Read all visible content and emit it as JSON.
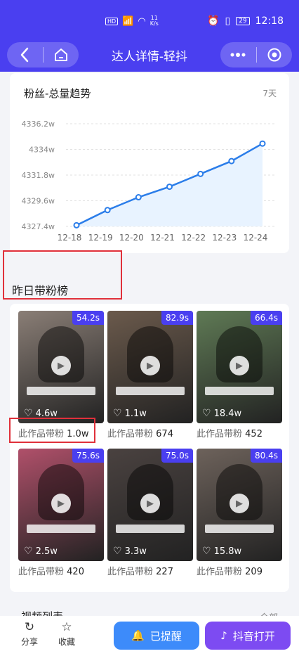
{
  "status_bar": {
    "hd": "HD",
    "net_speed_top": "11",
    "net_speed_bottom": "K/s",
    "battery": "29",
    "time": "12:18"
  },
  "nav": {
    "title": "达人详情-轻抖"
  },
  "fans_trend": {
    "title": "粉丝-总量趋势",
    "period": "7天"
  },
  "chart_data": {
    "type": "area",
    "title": "粉丝-总量趋势",
    "categories": [
      "12-18",
      "12-19",
      "12-20",
      "12-21",
      "12-22",
      "12-23",
      "12-24"
    ],
    "values": [
      4327.5,
      4328.8,
      4329.9,
      4330.8,
      4331.9,
      4333.0,
      4334.5
    ],
    "y_ticks": [
      "4336.2w",
      "4334w",
      "4331.8w",
      "4329.6w",
      "4327.4w"
    ],
    "ylim": [
      4327.4,
      4336.2
    ],
    "unit": "w",
    "grid": true,
    "line_color": "#2b7de9",
    "fill_color": "#e8f3ff"
  },
  "ranking": {
    "title": "昨日带粉榜",
    "caption_prefix": "此作品带粉",
    "videos": [
      {
        "duration": "54.2s",
        "likes": "4.6w",
        "fans": "1.0w",
        "color": "#8a7e76"
      },
      {
        "duration": "82.9s",
        "likes": "1.1w",
        "fans": "674",
        "color": "#6b5a4c"
      },
      {
        "duration": "66.4s",
        "likes": "18.4w",
        "fans": "452",
        "color": "#5f7a55"
      },
      {
        "duration": "75.6s",
        "likes": "2.5w",
        "fans": "420",
        "color": "#b0506a"
      },
      {
        "duration": "75.0s",
        "likes": "3.3w",
        "fans": "227",
        "color": "#4a4240"
      },
      {
        "duration": "80.4s",
        "likes": "15.8w",
        "fans": "209",
        "color": "#6d625b"
      }
    ]
  },
  "video_list": {
    "title": "视频列表",
    "all_label": "全部"
  },
  "bottom": {
    "share": "分享",
    "favorite": "收藏",
    "remind": "已提醒",
    "open_douyin": "抖音打开"
  },
  "colors": {
    "brand": "#4a3ff0",
    "highlight_box": "#e0303b",
    "remind_button": "#3d8bfa",
    "open_button": "#7d4bf2"
  }
}
